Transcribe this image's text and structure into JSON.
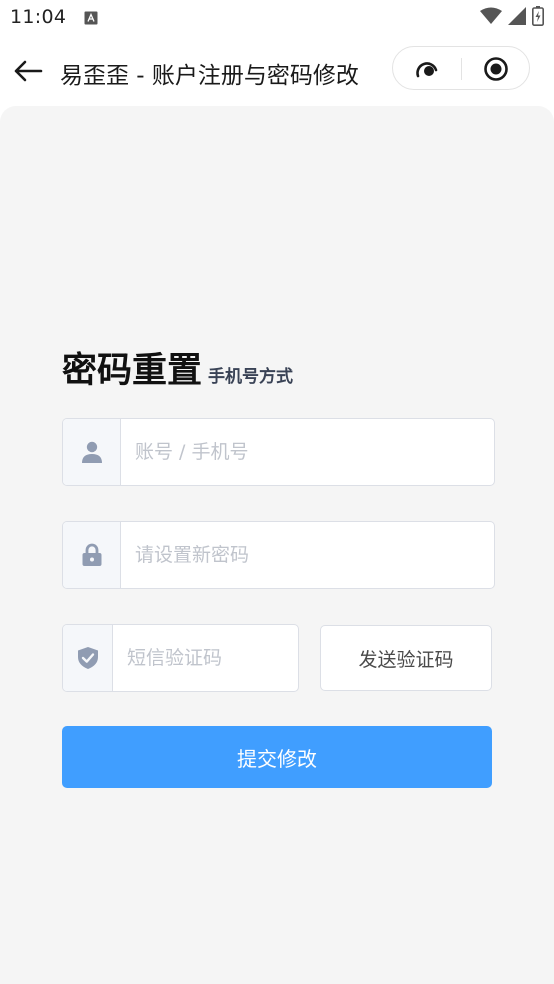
{
  "status_bar": {
    "time": "11:04"
  },
  "nav": {
    "title": "易歪歪 - 账户注册与密码修改"
  },
  "form": {
    "heading": "密码重置",
    "subheading": "手机号方式",
    "account_placeholder": "账号 / 手机号",
    "password_placeholder": "请设置新密码",
    "code_placeholder": "短信验证码",
    "send_code_label": "发送验证码",
    "submit_label": "提交修改"
  },
  "colors": {
    "primary": "#409eff",
    "icon": "#909cb2",
    "page_bg": "#f5f5f5"
  }
}
